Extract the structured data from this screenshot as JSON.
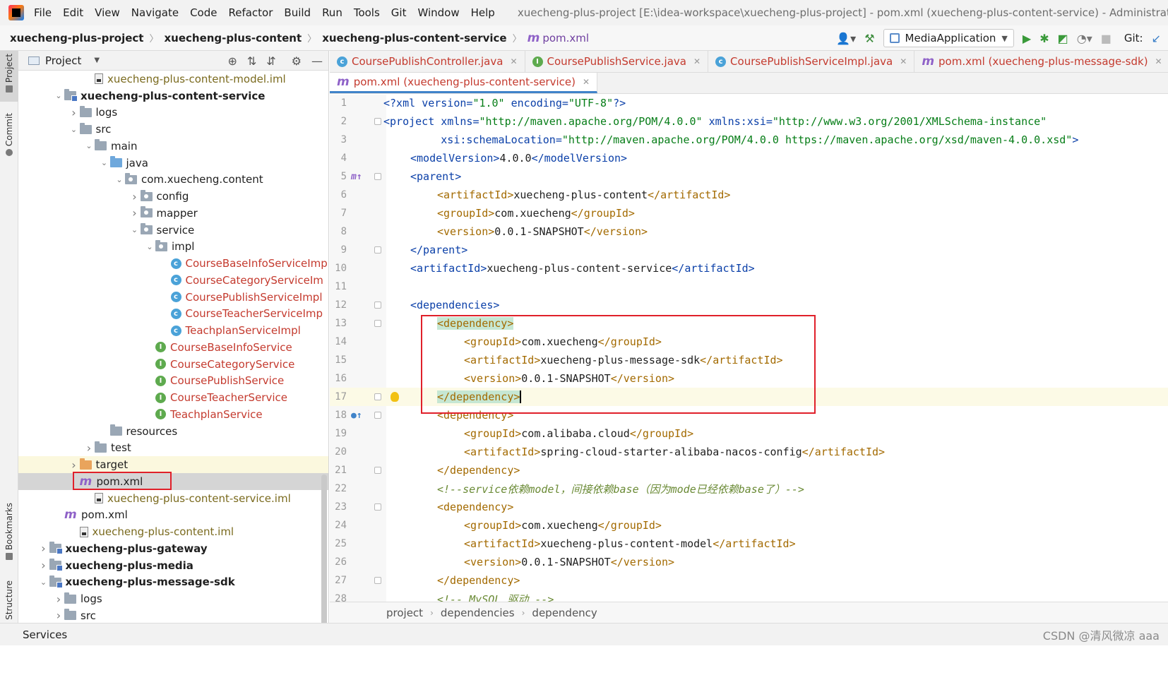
{
  "menubar": {
    "items": [
      "File",
      "Edit",
      "View",
      "Navigate",
      "Code",
      "Refactor",
      "Build",
      "Run",
      "Tools",
      "Git",
      "Window",
      "Help"
    ],
    "window_title": "xuecheng-plus-project [E:\\idea-workspace\\xuecheng-plus-project] - pom.xml (xuecheng-plus-content-service) - Administrator"
  },
  "navbar": {
    "crumbs": [
      "xuecheng-plus-project",
      "xuecheng-plus-content",
      "xuecheng-plus-content-service"
    ],
    "file": "pom.xml",
    "run_config": "MediaApplication",
    "git_label": "Git:"
  },
  "left_strip": {
    "project": "Project",
    "commit": "Commit",
    "bookmarks": "Bookmarks",
    "structure": "Structure"
  },
  "project_panel": {
    "title": "Project",
    "tree": [
      {
        "label": "xuecheng-plus-content-model.iml",
        "depth": 4,
        "icon": "iml",
        "arrow": "none",
        "style": "olive"
      },
      {
        "label": "xuecheng-plus-content-service",
        "depth": 2,
        "icon": "module",
        "arrow": "down",
        "style": "bold"
      },
      {
        "label": "logs",
        "depth": 3,
        "icon": "folder",
        "arrow": "right",
        "style": ""
      },
      {
        "label": "src",
        "depth": 3,
        "icon": "folder",
        "arrow": "down",
        "style": ""
      },
      {
        "label": "main",
        "depth": 4,
        "icon": "folder",
        "arrow": "down",
        "style": ""
      },
      {
        "label": "java",
        "depth": 5,
        "icon": "folder-blue",
        "arrow": "down",
        "style": ""
      },
      {
        "label": "com.xuecheng.content",
        "depth": 6,
        "icon": "package",
        "arrow": "down",
        "style": ""
      },
      {
        "label": "config",
        "depth": 7,
        "icon": "package",
        "arrow": "right",
        "style": ""
      },
      {
        "label": "mapper",
        "depth": 7,
        "icon": "package",
        "arrow": "right",
        "style": ""
      },
      {
        "label": "service",
        "depth": 7,
        "icon": "package",
        "arrow": "down",
        "style": ""
      },
      {
        "label": "impl",
        "depth": 8,
        "icon": "package",
        "arrow": "down",
        "style": ""
      },
      {
        "label": "CourseBaseInfoServiceImp",
        "depth": 9,
        "icon": "class",
        "arrow": "none",
        "style": "red"
      },
      {
        "label": "CourseCategoryServiceIm",
        "depth": 9,
        "icon": "class",
        "arrow": "none",
        "style": "red"
      },
      {
        "label": "CoursePublishServiceImpl",
        "depth": 9,
        "icon": "class",
        "arrow": "none",
        "style": "red"
      },
      {
        "label": "CourseTeacherServiceImp",
        "depth": 9,
        "icon": "class",
        "arrow": "none",
        "style": "red"
      },
      {
        "label": "TeachplanServiceImpl",
        "depth": 9,
        "icon": "class",
        "arrow": "none",
        "style": "red"
      },
      {
        "label": "CourseBaseInfoService",
        "depth": 8,
        "icon": "interface",
        "arrow": "none",
        "style": "red"
      },
      {
        "label": "CourseCategoryService",
        "depth": 8,
        "icon": "interface",
        "arrow": "none",
        "style": "red"
      },
      {
        "label": "CoursePublishService",
        "depth": 8,
        "icon": "interface",
        "arrow": "none",
        "style": "red"
      },
      {
        "label": "CourseTeacherService",
        "depth": 8,
        "icon": "interface",
        "arrow": "none",
        "style": "red"
      },
      {
        "label": "TeachplanService",
        "depth": 8,
        "icon": "interface",
        "arrow": "none",
        "style": "red"
      },
      {
        "label": "resources",
        "depth": 5,
        "icon": "folder",
        "arrow": "none",
        "style": ""
      },
      {
        "label": "test",
        "depth": 4,
        "icon": "folder",
        "arrow": "right",
        "style": ""
      },
      {
        "label": "target",
        "depth": 3,
        "icon": "folder-orange",
        "arrow": "right",
        "style": "",
        "row": "yellow"
      },
      {
        "label": "pom.xml",
        "depth": 3,
        "icon": "maven",
        "arrow": "none",
        "style": "",
        "row": "selected"
      },
      {
        "label": "xuecheng-plus-content-service.iml",
        "depth": 4,
        "icon": "iml",
        "arrow": "none",
        "style": "olive"
      },
      {
        "label": "pom.xml",
        "depth": 2,
        "icon": "maven",
        "arrow": "none",
        "style": ""
      },
      {
        "label": "xuecheng-plus-content.iml",
        "depth": 3,
        "icon": "iml",
        "arrow": "none",
        "style": "olive"
      },
      {
        "label": "xuecheng-plus-gateway",
        "depth": 1,
        "icon": "module",
        "arrow": "right",
        "style": "bold"
      },
      {
        "label": "xuecheng-plus-media",
        "depth": 1,
        "icon": "module",
        "arrow": "right",
        "style": "bold"
      },
      {
        "label": "xuecheng-plus-message-sdk",
        "depth": 1,
        "icon": "module",
        "arrow": "down",
        "style": "bold"
      },
      {
        "label": "logs",
        "depth": 2,
        "icon": "folder",
        "arrow": "right",
        "style": ""
      },
      {
        "label": "src",
        "depth": 2,
        "icon": "folder",
        "arrow": "right",
        "style": ""
      }
    ]
  },
  "editor_tabs_row1": [
    {
      "label": "CoursePublishController.java",
      "icon": "class"
    },
    {
      "label": "CoursePublishService.java",
      "icon": "interface"
    },
    {
      "label": "CoursePublishServiceImpl.java",
      "icon": "class"
    },
    {
      "label": "pom.xml (xuecheng-plus-message-sdk)",
      "icon": "maven"
    }
  ],
  "editor_tabs_row2": [
    {
      "label": "pom.xml (xuecheng-plus-content-service)",
      "icon": "maven",
      "active": true
    }
  ],
  "editor": {
    "lines": [
      {
        "n": "1",
        "indent": 0,
        "parts": [
          [
            "tag",
            "<?xml "
          ],
          [
            "attr",
            "version"
          ],
          [
            "tag",
            "="
          ],
          [
            "val",
            "\"1.0\""
          ],
          [
            "tag",
            " "
          ],
          [
            "attr",
            "encoding"
          ],
          [
            "tag",
            "="
          ],
          [
            "val",
            "\"UTF-8\""
          ],
          [
            "tag",
            "?>"
          ]
        ]
      },
      {
        "n": "2",
        "indent": 0,
        "fold": true,
        "parts": [
          [
            "tag",
            "<project "
          ],
          [
            "attr",
            "xmlns"
          ],
          [
            "tag",
            "="
          ],
          [
            "val",
            "\"http://maven.apache.org/POM/4.0.0\""
          ],
          [
            "tag",
            " "
          ],
          [
            "attr",
            "xmlns:xsi"
          ],
          [
            "tag",
            "="
          ],
          [
            "val",
            "\"http://www.w3.org/2001/XMLSchema-instance\""
          ]
        ]
      },
      {
        "n": "3",
        "indent": 0,
        "parts": [
          [
            "tag",
            "         "
          ],
          [
            "attr",
            "xsi:schemaLocation"
          ],
          [
            "tag",
            "="
          ],
          [
            "val",
            "\"http://maven.apache.org/POM/4.0.0 https://maven.apache.org/xsd/maven-4.0.0.xsd\""
          ],
          [
            "tag",
            ">"
          ]
        ]
      },
      {
        "n": "4",
        "indent": 1,
        "parts": [
          [
            "tag",
            "<modelVersion>"
          ],
          [
            "text",
            "4.0.0"
          ],
          [
            "tag",
            "</modelVersion>"
          ]
        ]
      },
      {
        "n": "5",
        "indent": 1,
        "fold": true,
        "gmark": "m↑",
        "parts": [
          [
            "tag",
            "<parent>"
          ]
        ]
      },
      {
        "n": "6",
        "indent": 2,
        "parts": [
          [
            "tagdim",
            "<artifactId>"
          ],
          [
            "text",
            "xuecheng-plus-content"
          ],
          [
            "tagdim",
            "</artifactId>"
          ]
        ]
      },
      {
        "n": "7",
        "indent": 2,
        "parts": [
          [
            "tagdim",
            "<groupId>"
          ],
          [
            "text",
            "com.xuecheng"
          ],
          [
            "tagdim",
            "</groupId>"
          ]
        ]
      },
      {
        "n": "8",
        "indent": 2,
        "parts": [
          [
            "tagdim",
            "<version>"
          ],
          [
            "text",
            "0.0.1-SNAPSHOT"
          ],
          [
            "tagdim",
            "</version>"
          ]
        ]
      },
      {
        "n": "9",
        "indent": 1,
        "fold": true,
        "parts": [
          [
            "tag",
            "</parent>"
          ]
        ]
      },
      {
        "n": "10",
        "indent": 1,
        "parts": [
          [
            "tag",
            "<artifactId>"
          ],
          [
            "text",
            "xuecheng-plus-content-service"
          ],
          [
            "tag",
            "</artifactId>"
          ]
        ]
      },
      {
        "n": "11",
        "indent": 0,
        "parts": []
      },
      {
        "n": "12",
        "indent": 1,
        "fold": true,
        "parts": [
          [
            "tag",
            "<dependencies>"
          ]
        ]
      },
      {
        "n": "13",
        "indent": 2,
        "fold": true,
        "parts": [
          [
            "hl",
            "<dependency>"
          ]
        ]
      },
      {
        "n": "14",
        "indent": 3,
        "parts": [
          [
            "tagdim",
            "<groupId>"
          ],
          [
            "text",
            "com.xuecheng"
          ],
          [
            "tagdim",
            "</groupId>"
          ]
        ]
      },
      {
        "n": "15",
        "indent": 3,
        "parts": [
          [
            "tagdim",
            "<artifactId>"
          ],
          [
            "text",
            "xuecheng-plus-message-sdk"
          ],
          [
            "tagdim",
            "</artifactId>"
          ]
        ]
      },
      {
        "n": "16",
        "indent": 3,
        "parts": [
          [
            "tagdim",
            "<version>"
          ],
          [
            "text",
            "0.0.1-SNAPSHOT"
          ],
          [
            "tagdim",
            "</version>"
          ]
        ]
      },
      {
        "n": "17",
        "indent": 2,
        "fold": true,
        "current": true,
        "bulb": true,
        "parts": [
          [
            "hl",
            "</dependency>"
          ],
          [
            "caret",
            ""
          ]
        ]
      },
      {
        "n": "18",
        "indent": 2,
        "fold": true,
        "gmark": "●↑",
        "gmarkblue": true,
        "parts": [
          [
            "tagdim",
            "<dependency>"
          ]
        ]
      },
      {
        "n": "19",
        "indent": 3,
        "parts": [
          [
            "tagdim",
            "<groupId>"
          ],
          [
            "text",
            "com.alibaba.cloud"
          ],
          [
            "tagdim",
            "</groupId>"
          ]
        ]
      },
      {
        "n": "20",
        "indent": 3,
        "parts": [
          [
            "tagdim",
            "<artifactId>"
          ],
          [
            "text",
            "spring-cloud-starter-alibaba-nacos-config"
          ],
          [
            "tagdim",
            "</artifactId>"
          ]
        ]
      },
      {
        "n": "21",
        "indent": 2,
        "fold": true,
        "parts": [
          [
            "tagdim",
            "</dependency>"
          ]
        ]
      },
      {
        "n": "22",
        "indent": 2,
        "parts": [
          [
            "comment",
            "<!--service依赖model，间接依赖base（因为mode已经依赖base了）-->"
          ]
        ]
      },
      {
        "n": "23",
        "indent": 2,
        "fold": true,
        "parts": [
          [
            "tagdim",
            "<dependency>"
          ]
        ]
      },
      {
        "n": "24",
        "indent": 3,
        "parts": [
          [
            "tagdim",
            "<groupId>"
          ],
          [
            "text",
            "com.xuecheng"
          ],
          [
            "tagdim",
            "</groupId>"
          ]
        ]
      },
      {
        "n": "25",
        "indent": 3,
        "parts": [
          [
            "tagdim",
            "<artifactId>"
          ],
          [
            "text",
            "xuecheng-plus-content-model"
          ],
          [
            "tagdim",
            "</artifactId>"
          ]
        ]
      },
      {
        "n": "26",
        "indent": 3,
        "parts": [
          [
            "tagdim",
            "<version>"
          ],
          [
            "text",
            "0.0.1-SNAPSHOT"
          ],
          [
            "tagdim",
            "</version>"
          ]
        ]
      },
      {
        "n": "27",
        "indent": 2,
        "fold": true,
        "parts": [
          [
            "tagdim",
            "</dependency>"
          ]
        ]
      },
      {
        "n": "28",
        "indent": 2,
        "parts": [
          [
            "comment",
            "<!-- MySQL 驱动 -->"
          ]
        ]
      }
    ]
  },
  "editor_breadcrumb": [
    "project",
    "dependencies",
    "dependency"
  ],
  "bottom": {
    "services": "Services",
    "watermark": "CSDN @清风微凉 aaa"
  }
}
